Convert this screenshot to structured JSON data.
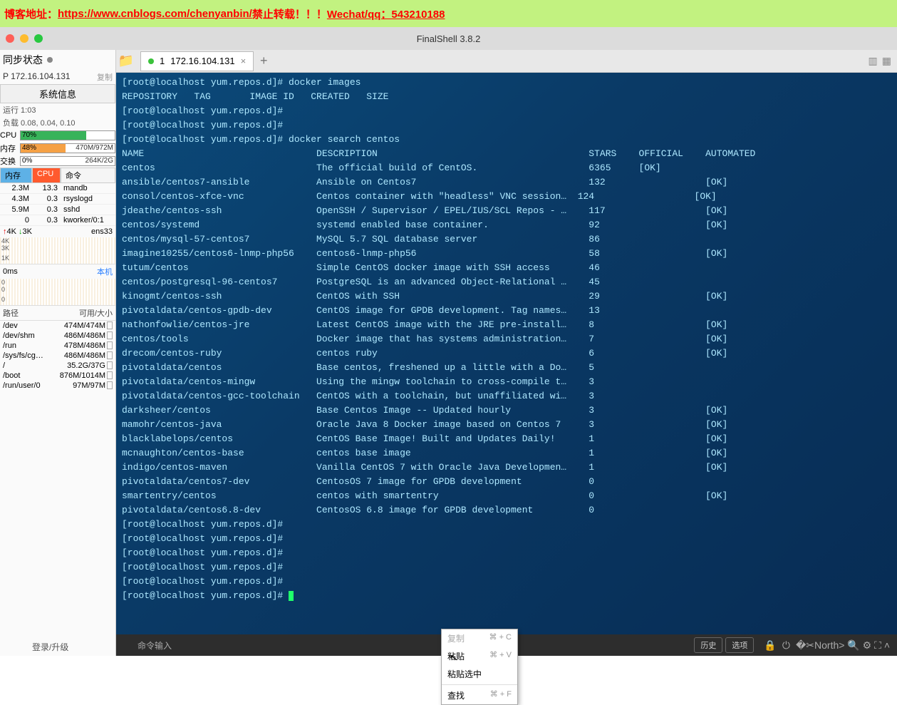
{
  "banner": {
    "prefix": "博客地址：",
    "url": "https://www.cnblogs.com/chenyanbin/",
    "mid": "      禁止转载！！！",
    "wechat": "Wechat/qq：543210188"
  },
  "window_title": "FinalShell 3.8.2",
  "sidebar": {
    "sync_label": "同步状态",
    "ip": "P 172.16.104.131",
    "copy": "复制",
    "sysinfo_btn": "系统信息",
    "uptime": "运行 1:03",
    "load": "负载 0.08, 0.04, 0.10",
    "cpu_label": "CPU",
    "cpu_pct": "70%",
    "mem_label": "内存",
    "mem_pct": "48%",
    "mem_right": "470M/972M",
    "swap_label": "交换",
    "swap_pct": "0%",
    "swap_right": "264K/2G",
    "h_mem": "内存",
    "h_cpu": "CPU",
    "h_cmd": "命令",
    "procs": [
      {
        "m": "2.3M",
        "c": "13.3",
        "n": "mandb"
      },
      {
        "m": "4.3M",
        "c": "0.3",
        "n": "rsyslogd"
      },
      {
        "m": "5.9M",
        "c": "0.3",
        "n": "sshd"
      },
      {
        "m": "0",
        "c": "0.3",
        "n": "kworker/0:1"
      }
    ],
    "net_up": "4K",
    "net_dn": "3K",
    "nic": "ens33",
    "latency": "0ms",
    "local": "本机",
    "path_h": "路径",
    "avail_h": "可用/大小",
    "disks": [
      {
        "p": "/dev",
        "s": "474M/474M"
      },
      {
        "p": "/dev/shm",
        "s": "486M/486M"
      },
      {
        "p": "/run",
        "s": "478M/486M"
      },
      {
        "p": "/sys/fs/cg…",
        "s": "486M/486M"
      },
      {
        "p": "/",
        "s": "35.2G/37G"
      },
      {
        "p": "/boot",
        "s": "876M/1014M"
      },
      {
        "p": "/run/user/0",
        "s": "97M/97M"
      }
    ],
    "login": "登录/升级"
  },
  "tab": {
    "index": "1",
    "label": "172.16.104.131"
  },
  "terminal_lines": [
    "[root@localhost yum.repos.d]# docker images",
    "REPOSITORY   TAG       IMAGE ID   CREATED   SIZE",
    "[root@localhost yum.repos.d]#",
    "[root@localhost yum.repos.d]#",
    "[root@localhost yum.repos.d]# docker search centos",
    "NAME                               DESCRIPTION                                      STARS    OFFICIAL    AUTOMATED",
    "centos                             The official build of CentOS.                    6365     [OK]",
    "ansible/centos7-ansible            Ansible on Centos7                               132                  [OK]",
    "consol/centos-xfce-vnc             Centos container with \"headless\" VNC session…  124                  [OK]",
    "jdeathe/centos-ssh                 OpenSSH / Supervisor / EPEL/IUS/SCL Repos - …    117                  [OK]",
    "centos/systemd                     systemd enabled base container.                  92                   [OK]",
    "centos/mysql-57-centos7            MySQL 5.7 SQL database server                    86",
    "imagine10255/centos6-lnmp-php56    centos6-lnmp-php56                               58                   [OK]",
    "tutum/centos                       Simple CentOS docker image with SSH access       46",
    "centos/postgresql-96-centos7       PostgreSQL is an advanced Object-Relational …    45",
    "kinogmt/centos-ssh                 CentOS with SSH                                  29                   [OK]",
    "pivotaldata/centos-gpdb-dev        CentOS image for GPDB development. Tag names…    13",
    "nathonfowlie/centos-jre            Latest CentOS image with the JRE pre-install…    8                    [OK]",
    "centos/tools                       Docker image that has systems administration…    7                    [OK]",
    "drecom/centos-ruby                 centos ruby                                      6                    [OK]",
    "pivotaldata/centos                 Base centos, freshened up a little with a Do…    5",
    "pivotaldata/centos-mingw           Using the mingw toolchain to cross-compile t…    3",
    "pivotaldata/centos-gcc-toolchain   CentOS with a toolchain, but unaffiliated wi…    3",
    "darksheer/centos                   Base Centos Image -- Updated hourly              3                    [OK]",
    "mamohr/centos-java                 Oracle Java 8 Docker image based on Centos 7     3                    [OK]",
    "blacklabelops/centos               CentOS Base Image! Built and Updates Daily!      1                    [OK]",
    "mcnaughton/centos-base             centos base image                                1                    [OK]",
    "indigo/centos-maven                Vanilla CentOS 7 with Oracle Java Developmen…    1                    [OK]",
    "pivotaldata/centos7-dev            CentosOS 7 image for GPDB development            0",
    "smartentry/centos                  centos with smartentry                           0                    [OK]",
    "pivotaldata/centos6.8-dev          CentosOS 6.8 image for GPDB development          0",
    "[root@localhost yum.repos.d]#",
    "[root@localhost yum.repos.d]#",
    "[root@localhost yum.repos.d]#",
    "[root@localhost yum.repos.d]#",
    "[root@localhost yum.repos.d]#",
    "[root@localhost yum.repos.d]#"
  ],
  "context_menu": [
    {
      "label": "复制",
      "sc": "⌘ + C",
      "disabled": true
    },
    {
      "label": "粘贴",
      "sc": "⌘ + V",
      "disabled": false
    },
    {
      "label": "粘贴选中",
      "sc": "",
      "disabled": false
    },
    {
      "label": "查找",
      "sc": "⌘ + F",
      "disabled": false
    }
  ],
  "bottom": {
    "input_placeholder": "命令输入",
    "history": "历史",
    "options": "选项"
  }
}
